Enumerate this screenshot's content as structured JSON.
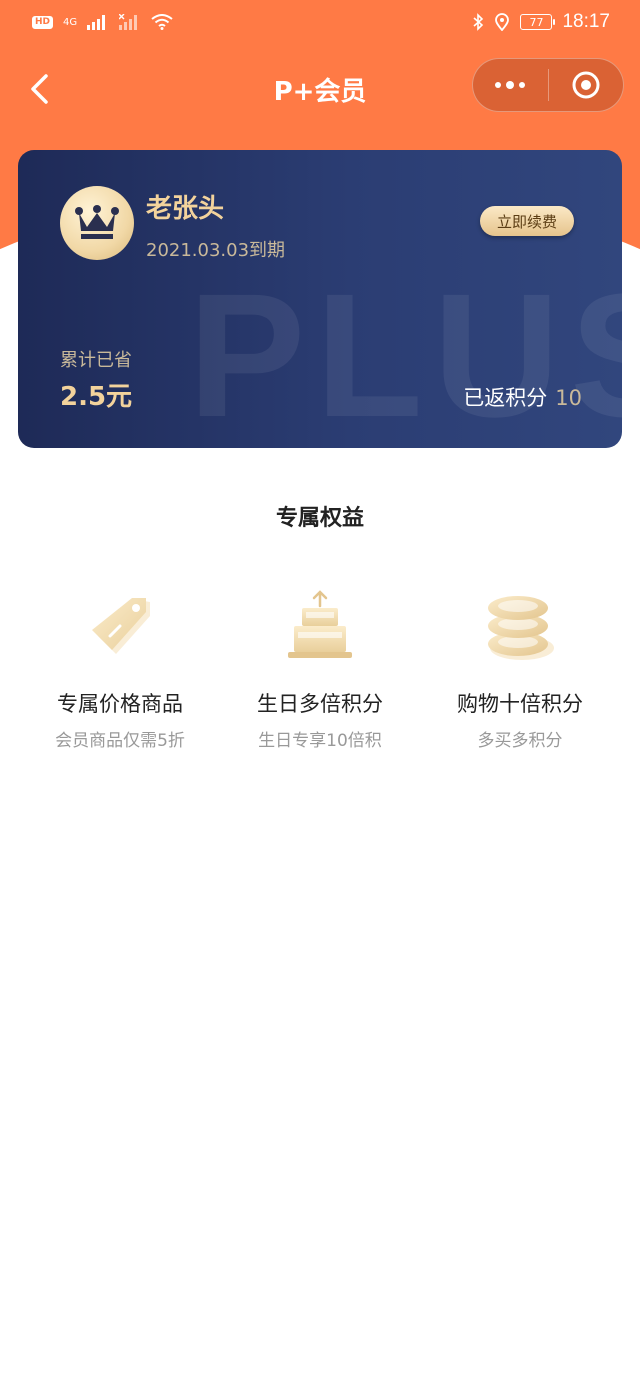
{
  "status_bar": {
    "hd_label": "HD",
    "network": "4G",
    "battery": "77",
    "time": "18:17"
  },
  "nav": {
    "title": "P+会员"
  },
  "card": {
    "user_name": "老张头",
    "expire_text": "2021.03.03到期",
    "renew_label": "立即续费",
    "watermark": "PLUS",
    "saved_label": "累计已省",
    "saved_value": "2.5元",
    "points_label": "已返积分",
    "points_value": "10"
  },
  "benefits": {
    "section_title": "专属权益",
    "items": [
      {
        "icon": "price-tag-icon",
        "title": "专属价格商品",
        "subtitle": "会员商品仅需5折"
      },
      {
        "icon": "birthday-cake-icon",
        "title": "生日多倍积分",
        "subtitle": "生日专享10倍积"
      },
      {
        "icon": "coin-stack-icon",
        "title": "购物十倍积分",
        "subtitle": "多买多积分"
      }
    ]
  },
  "colors": {
    "header": "#ff7a45",
    "card_dark": "#1e2a57",
    "gold": "#f3d39c"
  }
}
